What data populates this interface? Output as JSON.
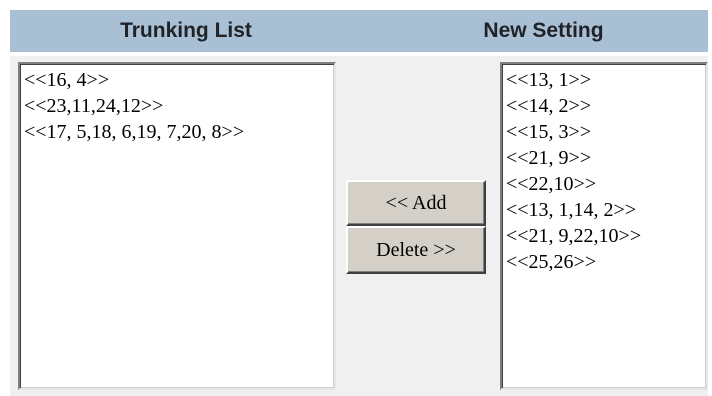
{
  "headers": {
    "trunking_list": "Trunking List",
    "new_setting": "New Setting"
  },
  "trunking_list": {
    "items": [
      "<<16, 4>>",
      "<<23,11,24,12>>",
      "<<17, 5,18, 6,19, 7,20, 8>>"
    ]
  },
  "new_setting": {
    "items": [
      "<<13, 1>>",
      "<<14, 2>>",
      "<<15, 3>>",
      "<<21, 9>>",
      "<<22,10>>",
      "<<13, 1,14, 2>>",
      "<<21, 9,22,10>>",
      "<<25,26>>"
    ]
  },
  "buttons": {
    "add_label": "<< Add",
    "delete_label": "Delete >>"
  },
  "colors": {
    "header_bg": "#a9bfd3",
    "panel_bg": "#f0f0f0",
    "button_face": "#d4d0c8"
  }
}
